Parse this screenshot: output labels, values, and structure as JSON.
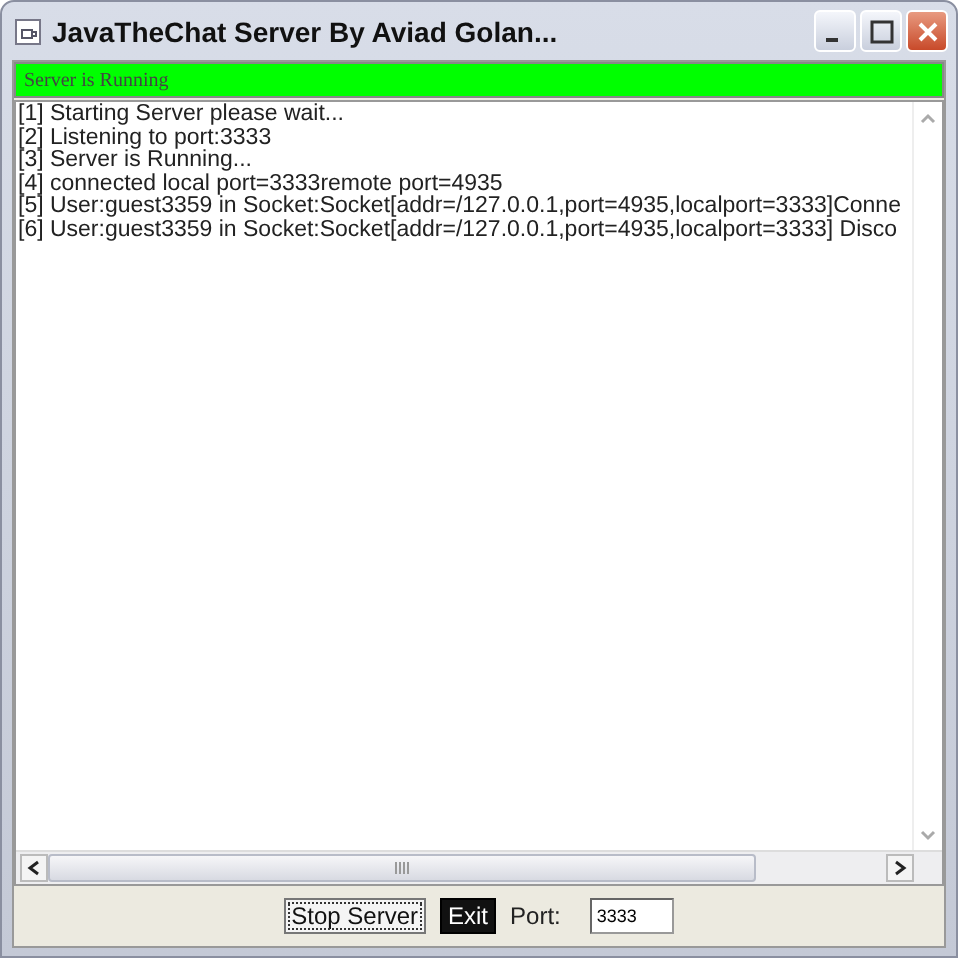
{
  "window": {
    "title": "JavaTheChat Server By Aviad Golan..."
  },
  "status": "Server is Running",
  "log": [
    "[1] Starting Server please wait...",
    "[2] Listening to port:3333",
    "[3] Server is Running...",
    "[4] connected local port=3333remote port=4935",
    "[5] User:guest3359 in Socket:Socket[addr=/127.0.0.1,port=4935,localport=3333]Conne",
    "[6] User:guest3359 in Socket:Socket[addr=/127.0.0.1,port=4935,localport=3333] Disco"
  ],
  "buttons": [
    {
      "label": "Stop Server",
      "kind": "focused"
    },
    {
      "label": "Exit",
      "kind": "dark"
    }
  ],
  "port": {
    "label": "Port:",
    "value": "3333"
  }
}
